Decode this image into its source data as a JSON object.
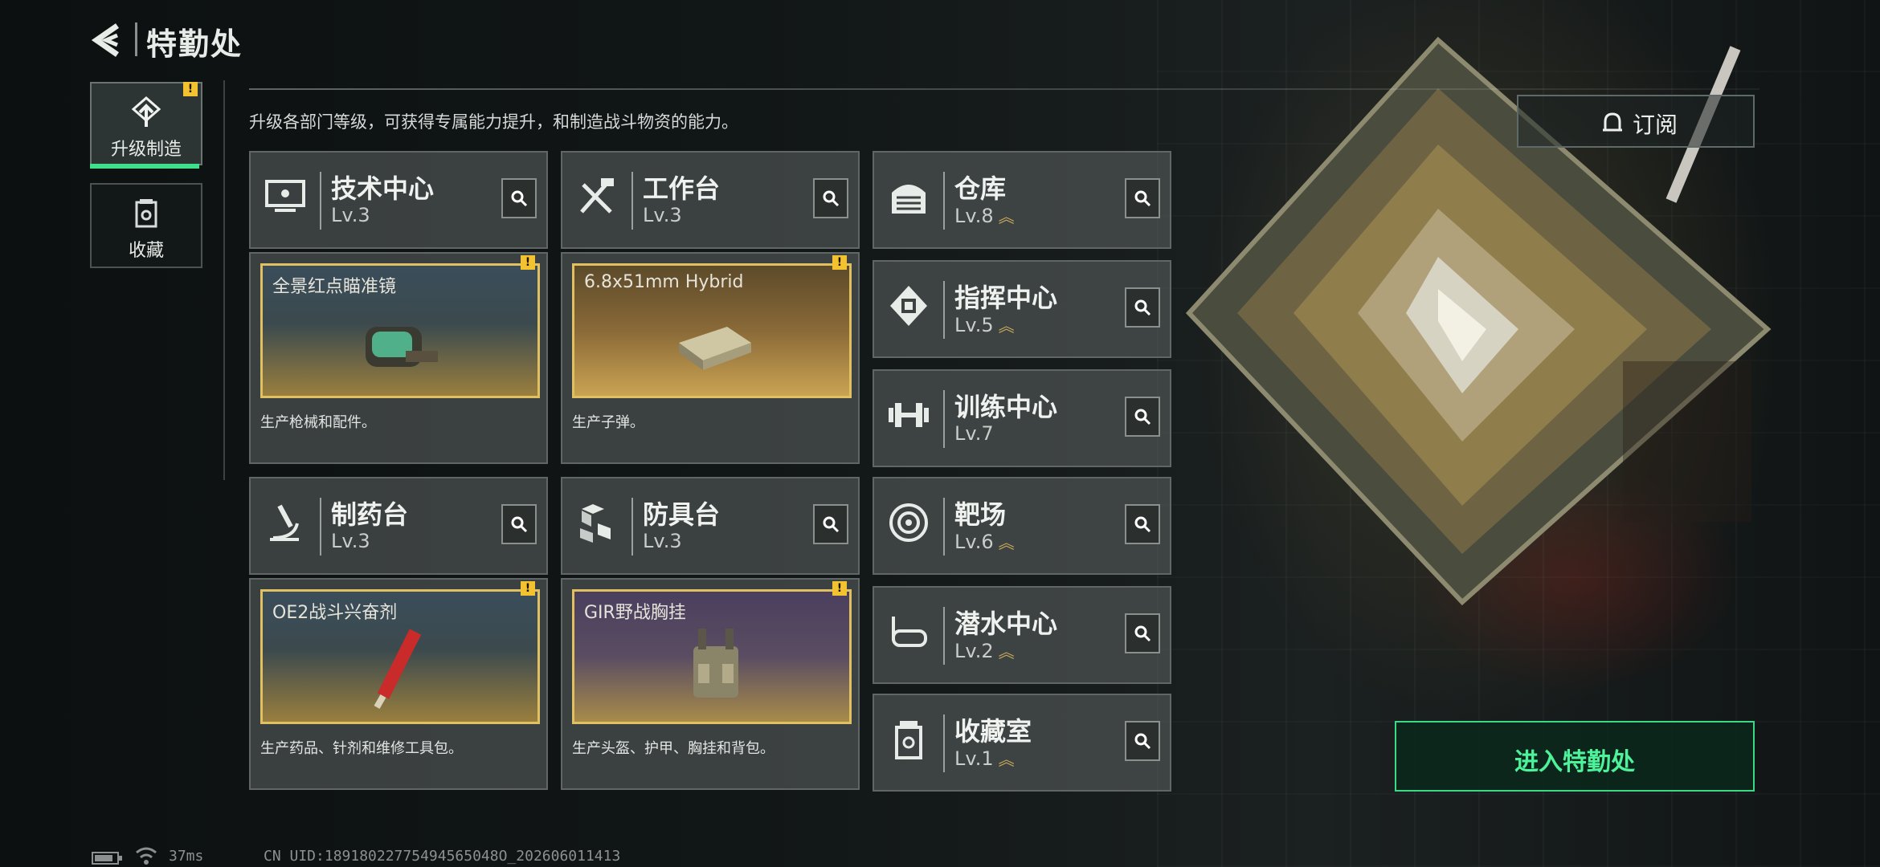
{
  "header": {
    "title": "特勤处"
  },
  "nav": {
    "tabs": [
      {
        "label": "升级制造",
        "active": true,
        "icon": "upgrade-icon"
      },
      {
        "label": "收藏",
        "active": false,
        "icon": "collection-icon"
      }
    ]
  },
  "badges": {
    "warn": "!"
  },
  "description": "升级各部门等级，可获得专属能力提升，和制造战斗物资的能力。",
  "departments": {
    "tech": {
      "name": "技术中心",
      "level": "Lv.3",
      "icon": "monitor-icon",
      "product": {
        "title": "全景红点瞄准镜",
        "desc": "生产枪械和配件。"
      }
    },
    "workbench": {
      "name": "工作台",
      "level": "Lv.3",
      "icon": "tools-icon",
      "product": {
        "title": "6.8x51mm Hybrid",
        "desc": "生产子弹。"
      }
    },
    "pharmacy": {
      "name": "制药台",
      "level": "Lv.3",
      "icon": "microscope-icon",
      "product": {
        "title": "OE2战斗兴奋剂",
        "desc": "生产药品、针剂和维修工具包。"
      }
    },
    "armor": {
      "name": "防具台",
      "level": "Lv.3",
      "icon": "boxes-icon",
      "product": {
        "title": "GIR野战胸挂",
        "desc": "生产头盔、护甲、胸挂和背包。"
      }
    },
    "warehouse": {
      "name": "仓库",
      "level": "Lv.8",
      "icon": "warehouse-icon"
    },
    "command": {
      "name": "指挥中心",
      "level": "Lv.5",
      "icon": "chip-icon"
    },
    "training": {
      "name": "训练中心",
      "level": "Lv.7",
      "icon": "dumbbell-icon"
    },
    "range": {
      "name": "靶场",
      "level": "Lv.6",
      "icon": "target-icon"
    },
    "diving": {
      "name": "潜水中心",
      "level": "Lv.2",
      "icon": "diving-mask-icon"
    },
    "collection": {
      "name": "收藏室",
      "level": "Lv.1",
      "icon": "collection-room-icon"
    }
  },
  "level_up_indicator": "︽",
  "subscribe": {
    "label": "订阅"
  },
  "enter": {
    "label": "进入特勤处"
  },
  "status": {
    "ping": "37ms",
    "uid": "CN UID:18918022775494565048O_202606011413"
  },
  "colors": {
    "accent": "#3fe08b",
    "warning": "#f2c230",
    "level_up": "#c9a95a"
  }
}
